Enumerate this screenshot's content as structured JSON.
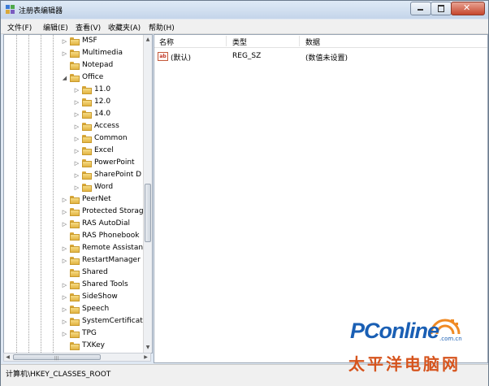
{
  "window": {
    "title": "注册表编辑器"
  },
  "menu": [
    "文件(F)",
    "编辑(E)",
    "查看(V)",
    "收藏夹(A)",
    "帮助(H)"
  ],
  "tree": [
    {
      "label": "MSF",
      "level": 0,
      "arrow": "▷"
    },
    {
      "label": "Multimedia",
      "level": 0,
      "arrow": "▷"
    },
    {
      "label": "Notepad",
      "level": 0,
      "arrow": ""
    },
    {
      "label": "Office",
      "level": 0,
      "arrow": "◢"
    },
    {
      "label": "11.0",
      "level": 1,
      "arrow": "▷"
    },
    {
      "label": "12.0",
      "level": 1,
      "arrow": "▷"
    },
    {
      "label": "14.0",
      "level": 1,
      "arrow": "▷"
    },
    {
      "label": "Access",
      "level": 1,
      "arrow": "▷"
    },
    {
      "label": "Common",
      "level": 1,
      "arrow": "▷"
    },
    {
      "label": "Excel",
      "level": 1,
      "arrow": "▷"
    },
    {
      "label": "PowerPoint",
      "level": 1,
      "arrow": "▷"
    },
    {
      "label": "SharePoint D",
      "level": 1,
      "arrow": "▷"
    },
    {
      "label": "Word",
      "level": 1,
      "arrow": "▷"
    },
    {
      "label": "PeerNet",
      "level": 0,
      "arrow": "▷"
    },
    {
      "label": "Protected Storag",
      "level": 0,
      "arrow": "▷"
    },
    {
      "label": "RAS AutoDial",
      "level": 0,
      "arrow": "▷"
    },
    {
      "label": "RAS Phonebook",
      "level": 0,
      "arrow": ""
    },
    {
      "label": "Remote Assistan",
      "level": 0,
      "arrow": "▷"
    },
    {
      "label": "RestartManager",
      "level": 0,
      "arrow": "▷"
    },
    {
      "label": "Shared",
      "level": 0,
      "arrow": ""
    },
    {
      "label": "Shared Tools",
      "level": 0,
      "arrow": "▷"
    },
    {
      "label": "SideShow",
      "level": 0,
      "arrow": "▷"
    },
    {
      "label": "Speech",
      "level": 0,
      "arrow": "▷"
    },
    {
      "label": "SystemCertificate",
      "level": 0,
      "arrow": "▷"
    },
    {
      "label": "TPG",
      "level": 0,
      "arrow": "▷"
    },
    {
      "label": "TXKey",
      "level": 0,
      "arrow": ""
    }
  ],
  "list": {
    "columns": [
      "名称",
      "类型",
      "数据"
    ],
    "rows": [
      {
        "icon": "ab",
        "name": "(默认)",
        "type": "REG_SZ",
        "data": "(数值未设置)"
      }
    ]
  },
  "status": {
    "path": "计算机\\HKEY_CLASSES_ROOT"
  },
  "watermark": {
    "logo": "PConline",
    "domain": ".com.cn",
    "chinese": "太平洋电脑网"
  },
  "colors": {
    "folder": "#e2b443",
    "accent": "#1a5fb4",
    "watermark_cn": "#d6541d"
  },
  "icons": {
    "app": "registry-editor-icon",
    "value": "string-value-icon",
    "folder": "folder-icon"
  }
}
